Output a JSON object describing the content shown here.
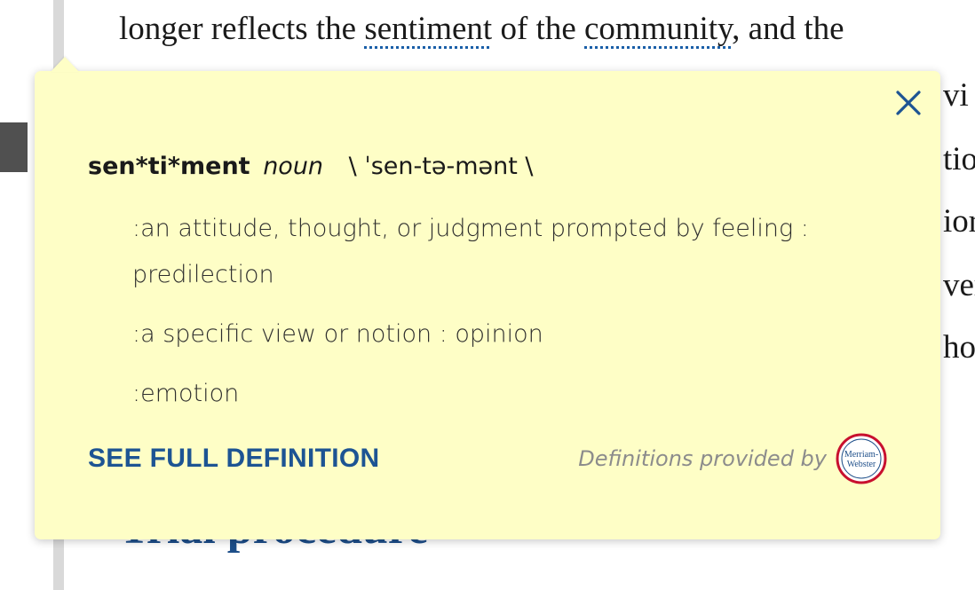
{
  "article": {
    "line1": {
      "before": "longer reflects the ",
      "term1": "sentiment",
      "middle": " of the ",
      "term2": "community",
      "after": ", and the"
    },
    "right_fragments": [
      "vi",
      "tio",
      "ior",
      "ver",
      "ho"
    ],
    "section_heading": "Trial procedure"
  },
  "popup": {
    "close_icon": "close-icon",
    "headword": "sen*ti*ment",
    "part_of_speech": "noun",
    "pronunciation": "\\ ˈsen-tə-mənt \\",
    "definitions": [
      ":an attitude, thought, or judgment prompted by feeling : predilection",
      ":a specific view or notion : opinion",
      ":emotion"
    ],
    "see_full_label": "SEE FULL DEFINITION",
    "provided_by": "Definitions provided by",
    "logo": {
      "icon": "merriam-webster-logo",
      "text_top": "Merriam-",
      "text_bottom": "Webster"
    }
  },
  "colors": {
    "popup_bg": "#fefec6",
    "accent": "#1d5493",
    "logo_red": "#c8102e",
    "logo_blue": "#1d4e89"
  }
}
